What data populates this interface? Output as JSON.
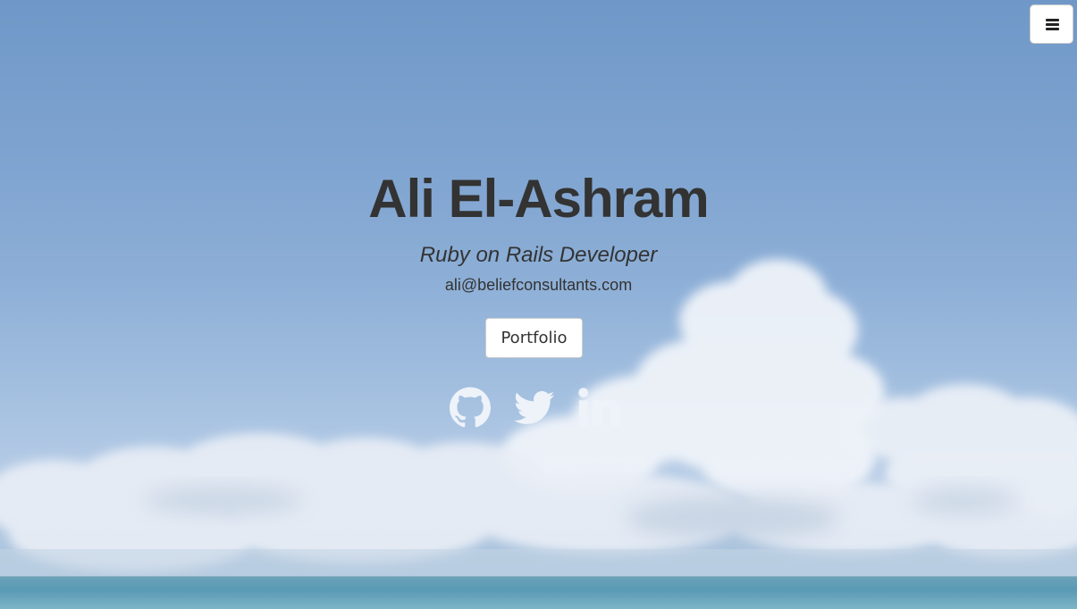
{
  "profile": {
    "name": "Ali El-Ashram",
    "title": "Ruby on Rails Developer",
    "email": "ali@beliefconsultants.com"
  },
  "actions": {
    "portfolio_label": "Portfolio"
  },
  "social": [
    {
      "icon": "github-icon"
    },
    {
      "icon": "twitter-icon"
    },
    {
      "icon": "linkedin-icon"
    }
  ],
  "menu": {
    "icon": "hamburger-menu-icon"
  },
  "colors": {
    "text": "#333333",
    "sky": "#7ea3d0",
    "social_icons": "#eef3f9"
  }
}
